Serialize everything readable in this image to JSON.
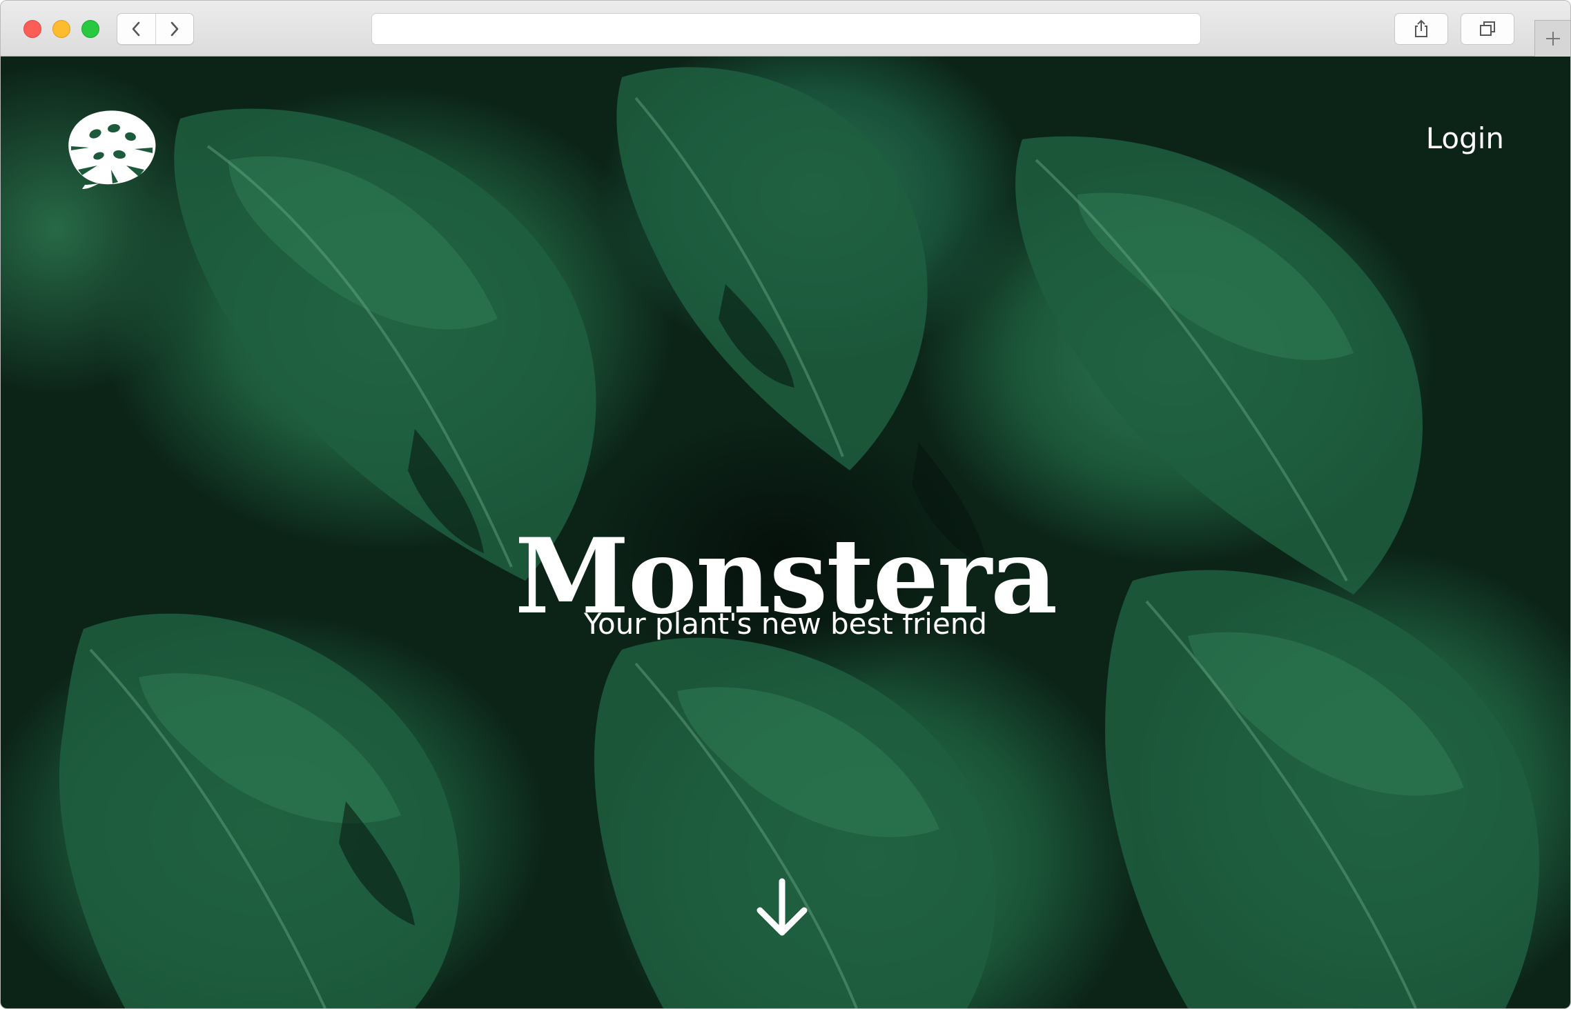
{
  "browser": {
    "address_bar": {
      "value": ""
    },
    "buttons": {
      "back_icon": "chevron-left-icon",
      "forward_icon": "chevron-right-icon",
      "share_icon": "share-icon",
      "tabs_icon": "tabs-icon",
      "new_tab_icon": "plus-icon"
    },
    "traffic_light_colors": {
      "close": "#fc5d57",
      "minimize": "#fdbb2e",
      "zoom": "#28c840"
    }
  },
  "site": {
    "logo_icon": "monstera-leaf-icon",
    "nav": {
      "login_label": "Login"
    },
    "hero": {
      "title": "Monstera",
      "subtitle": "Your plant's new best friend",
      "scroll_icon": "arrow-down-icon"
    },
    "colors": {
      "text": "#ffffff",
      "leaf_dark": "#0c2418",
      "leaf_mid": "#1d5a3b",
      "leaf_light": "#2f7a54"
    }
  }
}
